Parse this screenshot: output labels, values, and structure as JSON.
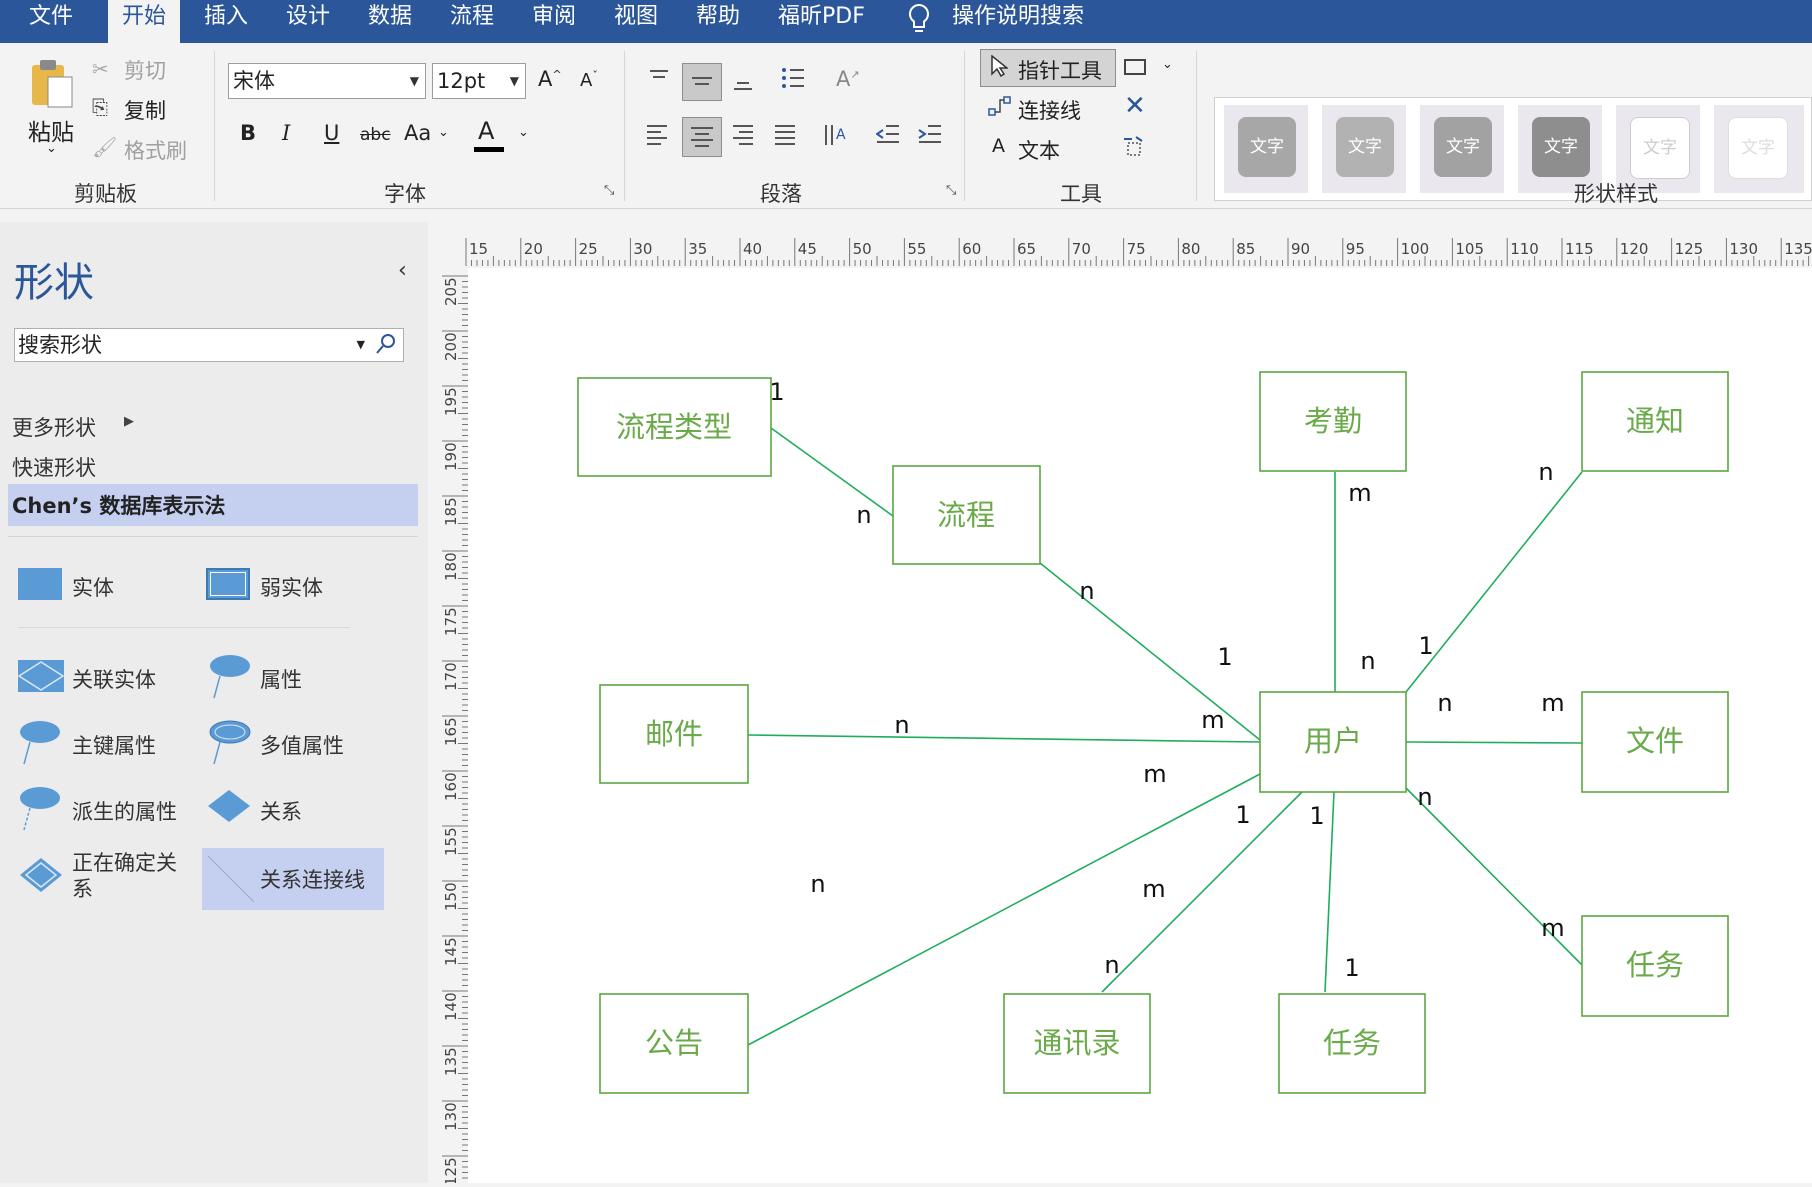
{
  "menu": [
    "文件",
    "开始",
    "插入",
    "设计",
    "数据",
    "流程",
    "审阅",
    "视图",
    "帮助",
    "福昕PDF"
  ],
  "menu_active_index": 1,
  "tell_me": "操作说明搜索",
  "clipboard": {
    "paste": "粘贴",
    "cut": "剪切",
    "copy": "复制",
    "format_painter": "格式刷",
    "label": "剪贴板"
  },
  "font": {
    "name": "宋体",
    "size": "12pt",
    "label": "字体",
    "bold": "B",
    "italic": "I",
    "underline": "U",
    "strike": "abc",
    "case": "Aa",
    "color_letter": "A"
  },
  "paragraph": {
    "label": "段落"
  },
  "tools": {
    "pointer": "指针工具",
    "connector": "连接线",
    "text": "文本",
    "label": "工具"
  },
  "shape_styles": {
    "label": "形状样式",
    "tiles": [
      "文字",
      "文字",
      "文字",
      "文字",
      "文字",
      "文字"
    ]
  },
  "panel": {
    "title": "形状",
    "search_placeholder": "搜索形状",
    "more_shapes": "更多形状",
    "quick_shapes": "快速形状",
    "stencil": "Chen’s 数据库表示法",
    "shapes": [
      "实体",
      "弱实体",
      "关联实体",
      "属性",
      "主键属性",
      "多值属性",
      "派生的属性",
      "关系",
      "正在确定关系",
      "关系连接线"
    ]
  },
  "ruler": {
    "top": [
      "15",
      "20",
      "25",
      "30",
      "35",
      "40",
      "45",
      "50",
      "55",
      "60",
      "65",
      "70",
      "75",
      "80",
      "85",
      "90",
      "95",
      "100",
      "105",
      "110",
      "115",
      "120",
      "125",
      "130",
      "135"
    ],
    "left": [
      "205",
      "200",
      "195",
      "190",
      "185",
      "180",
      "175",
      "170",
      "165",
      "160",
      "155",
      "150",
      "145",
      "140",
      "135",
      "130",
      "125"
    ]
  },
  "diagram": {
    "entities": [
      "流程类型",
      "流程",
      "考勤",
      "通知",
      "邮件",
      "用户",
      "文件",
      "任务",
      "公告",
      "通讯录",
      "任务"
    ],
    "labels": [
      "1",
      "n",
      "n",
      "1",
      "m",
      "n",
      "1",
      "n",
      "n",
      "m",
      "n",
      "m",
      "m",
      "m",
      "1",
      "1",
      "n",
      "1",
      "n",
      "m",
      "n"
    ],
    "colors": {
      "entity_border": "#5aa642",
      "entity_text": "#6aaa4a",
      "connector": "#1fad5c"
    }
  }
}
